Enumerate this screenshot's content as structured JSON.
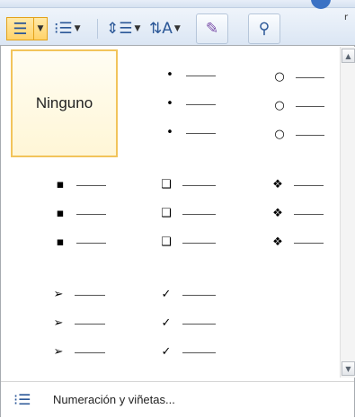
{
  "toolbar": {
    "buttons": [
      "bullets-split",
      "numbering",
      "line-spacing",
      "sort",
      "styles",
      "find"
    ],
    "right_char": "r"
  },
  "bullet_library": {
    "none_label": "Ninguno",
    "rows": [
      [
        "•",
        "•",
        "•"
      ],
      [
        "○",
        "○",
        "○"
      ],
      [
        "▪",
        "▪",
        "▪"
      ],
      [
        "❑",
        "❑",
        "❑"
      ],
      [
        "❖",
        "❖",
        "❖"
      ],
      [
        "➢",
        "➢",
        "➢"
      ],
      [
        "✓",
        "✓",
        "✓"
      ]
    ]
  },
  "footer": {
    "label": "Numeración y viñetas..."
  }
}
